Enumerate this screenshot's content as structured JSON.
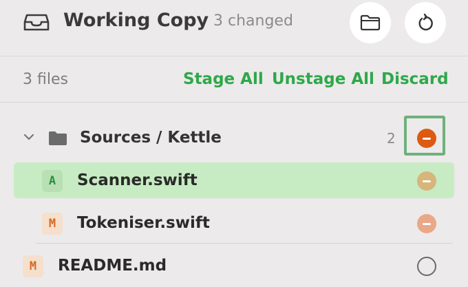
{
  "header": {
    "title": "Working Copy",
    "changed": "3 changed",
    "icons": [
      "inbox-icon",
      "folder-icon",
      "refresh-icon"
    ]
  },
  "toolbar": {
    "file_count": "3 files",
    "stage_all": "Stage All",
    "unstage_all": "Unstage All",
    "discard": "Discard"
  },
  "group": {
    "label": "Sources / Kettle",
    "count": "2",
    "expanded": true
  },
  "files": [
    {
      "status": "A",
      "name": "Scanner.swift",
      "selected": true
    },
    {
      "status": "M",
      "name": "Tokeniser.swift",
      "selected": false
    },
    {
      "status": "M",
      "name": "README.md",
      "selected": false
    }
  ],
  "colors": {
    "accent_green": "#2ea84a",
    "discard_orange": "#dc5a12",
    "selection_bg": "#c7ecc3",
    "focus_ring": "#6fb07c"
  }
}
